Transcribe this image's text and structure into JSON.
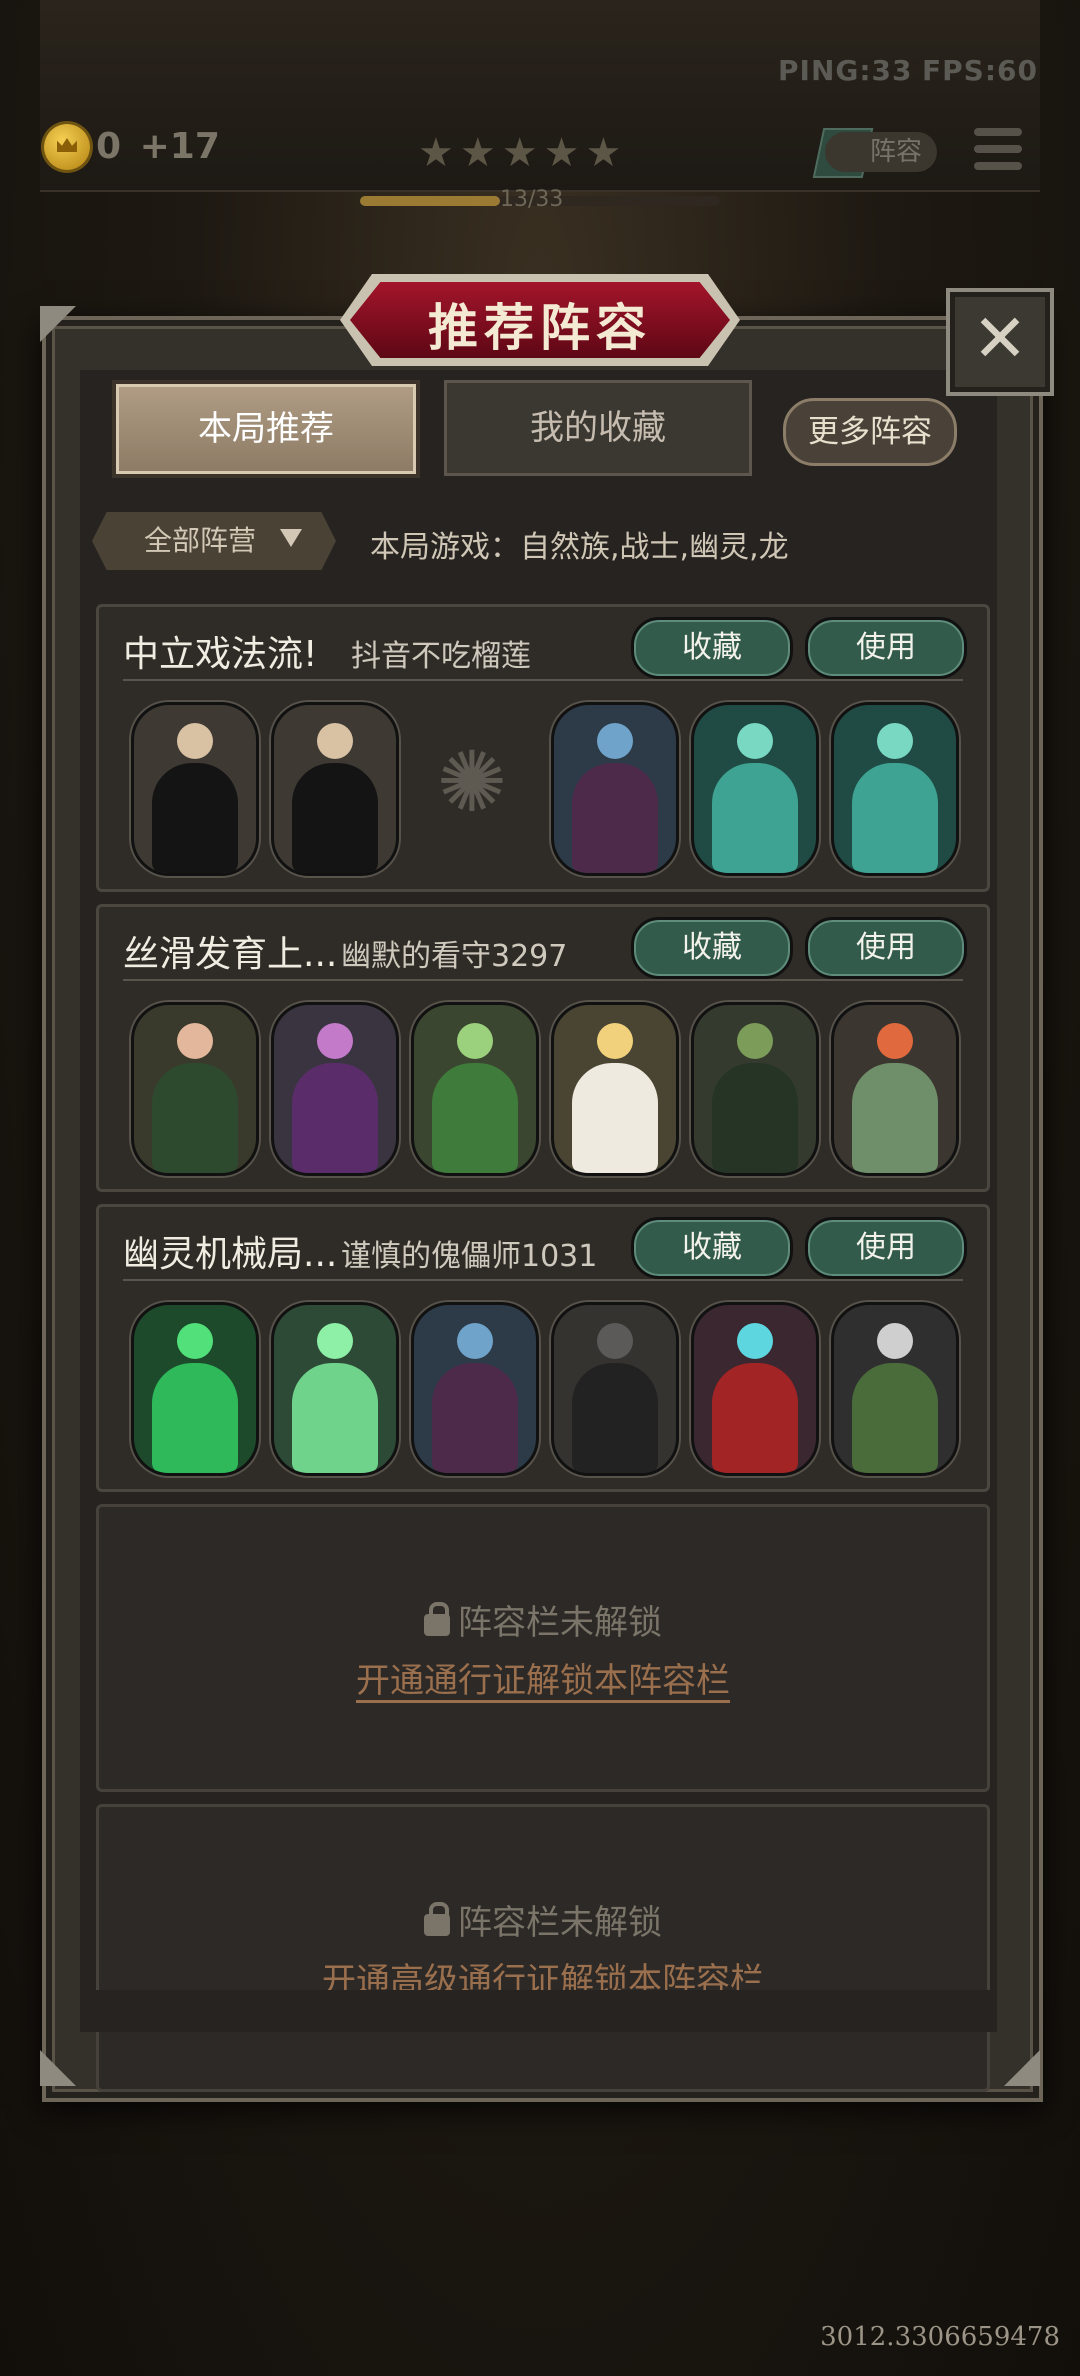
{
  "hud": {
    "ping": "PING:33",
    "fps": "FPS:60",
    "coins": "0",
    "coin_gain": "+17",
    "stars": "★★★★★",
    "progress_label": "13/33",
    "progress_fraction": 0.39,
    "lineup_button": "阵容",
    "bottom_counter": "3012.3306659478"
  },
  "modal": {
    "title": "推荐阵容",
    "close_label": "✕",
    "tabs": [
      {
        "label": "本局推荐",
        "active": true
      },
      {
        "label": "我的收藏",
        "active": false
      }
    ],
    "more_lineups": "更多阵容",
    "filter_label": "全部阵营",
    "game_label": "本局游戏：自然族,战士,幽灵,龙"
  },
  "lineups": [
    {
      "title": "中立戏法流!",
      "author": "抖音不吃榴莲",
      "fav_label": "收藏",
      "use_label": "使用",
      "units": [
        "magician",
        "magician",
        "empty",
        "elf-sorceress",
        "water-spirit",
        "water-spirit"
      ]
    },
    {
      "title": "丝滑发育上...",
      "author": "幽默的看守3297",
      "fav_label": "收藏",
      "use_label": "使用",
      "units": [
        "rose-elf",
        "bunny-elf",
        "leaf-dryad",
        "flower-fairy",
        "cactus-lady",
        "flame-dryad"
      ]
    },
    {
      "title": "幽灵机械局...",
      "author": "谨慎的傀儡师1031",
      "fav_label": "收藏",
      "use_label": "使用",
      "units": [
        "green-ghost-warrior",
        "ghost-cat",
        "elf-sorceress",
        "hooded-rogue",
        "spectral-mage",
        "reaper"
      ]
    }
  ],
  "locked_slots": [
    {
      "status": "阵容栏未解锁",
      "action": "开通通行证解锁本阵容栏"
    },
    {
      "status": "阵容栏未解锁",
      "action": "开通高级通行证解锁本阵容栏"
    }
  ],
  "colors": {
    "accent_green": "#325b4b",
    "banner_red": "#a3152a",
    "panel": "#34302a",
    "lock_link": "#9a6f4d"
  }
}
